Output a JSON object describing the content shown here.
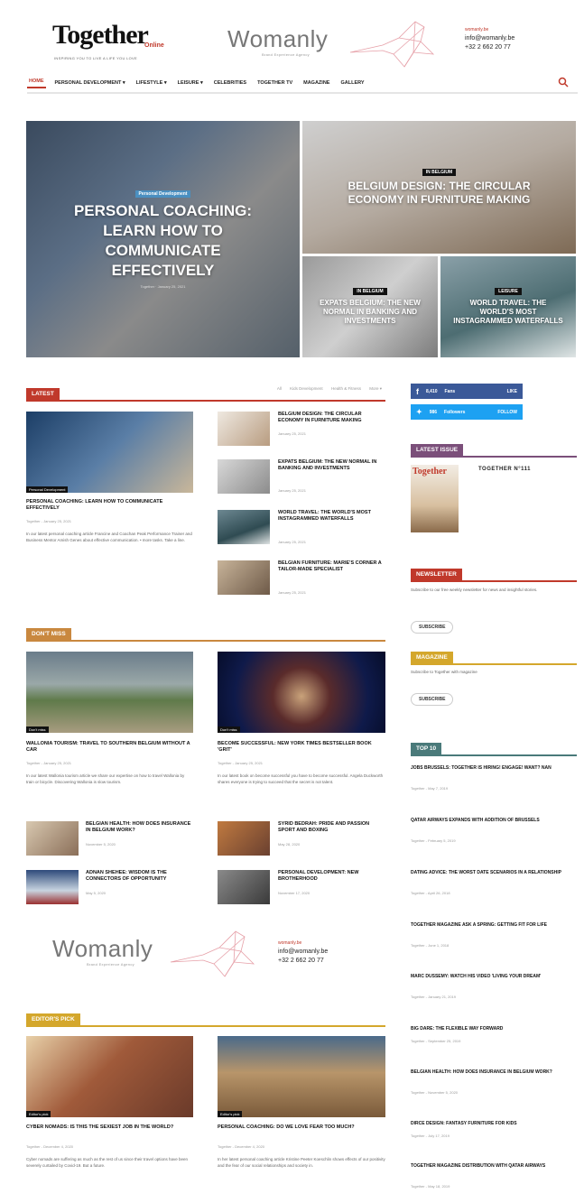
{
  "header": {
    "logo": "Together",
    "logo_sub": "Online",
    "logo_tag": "INSPIRING YOU TO LIVE A LIFE YOU LOVE",
    "womanly": "Womanly",
    "womanly_sub": "Brand Experience Agency",
    "contact_site": "womanly.be",
    "contact_email": "info@womanly.be",
    "contact_phone": "+32 2 662 20 77"
  },
  "nav": {
    "items": [
      "HOME",
      "PERSONAL DEVELOPMENT ▾",
      "LIFESTYLE ▾",
      "LEISURE ▾",
      "CELEBRITIES",
      "TOGETHER TV",
      "MAGAZINE",
      "GALLERY"
    ]
  },
  "featured": {
    "main": {
      "cat": "Personal Development",
      "title": "PERSONAL COACHING: LEARN HOW TO COMMUNICATE EFFECTIVELY",
      "meta": "Together  ·  January 25, 2021"
    },
    "top": {
      "cat": "IN BELGIUM",
      "title": "BELGIUM DESIGN: THE CIRCULAR ECONOMY IN FURNITURE MAKING"
    },
    "left": {
      "cat": "IN BELGIUM",
      "title": "EXPATS BELGIUM: THE NEW NORMAL IN BANKING AND INVESTMENTS"
    },
    "right": {
      "cat": "LEISURE",
      "title": "WORLD TRAVEL: THE WORLD'S MOST INSTAGRAMMED WATERFALLS"
    }
  },
  "latest": {
    "label": "LATEST",
    "tabs": [
      "All",
      "Kids Development",
      "Health & Fitness",
      "More ▾"
    ],
    "main": {
      "cat": "Personal Development",
      "title": "PERSONAL COACHING: LEARN HOW TO COMMUNICATE EFFECTIVELY",
      "meta": "Together  -  January 25, 2021",
      "excerpt": "In our latest personal coaching article Francine and Coachan Peak Performance Trainer and Business Mentor Amish Genes about effective communication. • more tasks. Take a line."
    },
    "list": [
      {
        "title": "BELGIUM DESIGN: THE CIRCULAR ECONOMY IN FURNITURE MAKING",
        "meta": "January 25, 2021"
      },
      {
        "title": "EXPATS BELGIUM: THE NEW NORMAL IN BANKING AND INVESTMENTS",
        "meta": "January 25, 2021"
      },
      {
        "title": "WORLD TRAVEL: THE WORLD'S MOST INSTAGRAMMED WATERFALLS",
        "meta": "January 25, 2021"
      },
      {
        "title": "BELGIAN FURNITURE: MARIE'S CORNER A TAILOR-MADE SPECIALIST",
        "meta": "January 25, 2021"
      }
    ]
  },
  "dontmiss": {
    "label": "DON'T MISS",
    "big": [
      {
        "cat": "Don't miss",
        "title": "WALLONIA TOURISM: TRAVEL TO SOUTHERN BELGIUM WITHOUT A CAR",
        "meta": "Together  -  January 25, 2021",
        "excerpt": "In our latest Wallonia tourism article we share our expertise on how to travel Wallonia by train or bicycle. Discovering Wallonia is slow tourism."
      },
      {
        "cat": "Don't miss",
        "title": "BECOME SUCCESSFUL: NEW YORK TIMES BESTSELLER BOOK 'GRIT'",
        "meta": "Together  -  January 25, 2021",
        "excerpt": "In our latest book on become successful you have to become successful. Angela Duckworth shares everyone is trying to succeed that the secret is not talent."
      }
    ],
    "small": [
      {
        "title": "BELGIAN HEALTH: HOW DOES INSURANCE IN BELGIUM WORK?",
        "meta": "November 5, 2020"
      },
      {
        "title": "SYRID BEDRAH: PRIDE AND PASSION SPORT AND BOXING",
        "meta": "May 28, 2020"
      },
      {
        "title": "ADNAN SHEHEE: WISDOM IS THE CONNECTORS OF OPPORTUNITY",
        "meta": "May 5, 2020"
      },
      {
        "title": "PERSONAL DEVELOPMENT: NEW BROTHERHOOD",
        "meta": "November 17, 2020"
      }
    ]
  },
  "banner": {
    "womanly": "Womanly",
    "sub": "Brand Experience Agency",
    "site": "womanly.be",
    "email": "info@womanly.be",
    "phone": "+32 2 662 20 77"
  },
  "editors": {
    "label": "EDITOR'S PICK",
    "items": [
      {
        "cat": "Editor's pick",
        "title": "CYBER NOMADS: IS THIS THE SEXIEST JOB IN THE WORLD?",
        "meta": "Together  -  December 4, 2020",
        "excerpt": "Cyber nomads are suffering as much as the rest of us since their travel options have been severely curtailed by Covid-19. But a future."
      },
      {
        "cat": "Editor's pick",
        "title": "PERSONAL COACHING: DO WE LOVE FEAR TOO MUCH?",
        "meta": "Together  -  December 4, 2020",
        "excerpt": "In her latest personal coaching article Kristine Peeter Koeschlin shows effects of our positivity and the fear of our social relationships and society in."
      }
    ]
  },
  "sidebar": {
    "facebook": {
      "count": "8,410",
      "word": "Fans",
      "action": "LIKE"
    },
    "twitter": {
      "count": "986",
      "word": "Followers",
      "action": "FOLLOW"
    },
    "latest_issue_label": "LATEST ISSUE",
    "issue_cover": "Together",
    "issue_title": "TOGETHER N°111",
    "newsletter_label": "NEWSLETTER",
    "newsletter_text": "Subscribe to our free weekly newsletter for news and insightful stories.",
    "subscribe": "SUBSCRIBE",
    "magazine_label": "MAGAZINE",
    "magazine_text": "Subscribe to Together with magazine",
    "subscribe2": "SUBSCRIBE",
    "top10_label": "TOP 10",
    "top10": [
      {
        "title": "JOBS BRUSSELS: TOGETHER IS HIRING! ENGAGE! WANT? NAN",
        "meta": "Together  -  May 7, 2019"
      },
      {
        "title": "QATAR AIRWAYS EXPANDS WITH ADDITION OF BRUSSELS",
        "meta": "Together  -  February 5, 2019"
      },
      {
        "title": "DATING ADVICE: THE WORST DATE SCENARIOS IN A RELATIONSHIP",
        "meta": "Together  -  April 26, 2018"
      },
      {
        "title": "TOGETHER MAGAZINE ASK A SPRING: GETTING FIT FOR LIFE",
        "meta": "Together  -  June 1, 2018"
      },
      {
        "title": "MARC DUSSEMY: WATCH HIS VIDEO 'LIVING YOUR DREAM'",
        "meta": "Together  -  January 21, 2019"
      },
      {
        "title": "BIG DARE: THE FLEXIBLE WAY FORWARD",
        "meta": "Together  -  September 25, 2019"
      },
      {
        "title": "BELGIAN HEALTH: HOW DOES INSURANCE IN BELGIUM WORK?",
        "meta": "Together  -  November 5, 2020"
      },
      {
        "title": "DIRCE DESIGN: FANTASY FURNITURE FOR KIDS",
        "meta": "Together  -  July 17, 2019"
      },
      {
        "title": "TOGETHER MAGAZINE DISTRIBUTION WITH QATAR AIRWAYS",
        "meta": "Together  -  May 18, 2019"
      }
    ]
  },
  "colors": {
    "red": "#c0392b",
    "orange": "#c9883f",
    "purple": "#7b4f7a",
    "gold": "#d4a72c",
    "teal": "#4a7a7a",
    "fb": "#3b5998",
    "tw": "#1da1f2"
  }
}
